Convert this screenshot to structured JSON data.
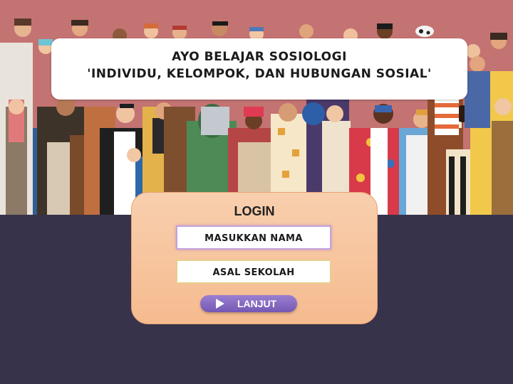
{
  "title": {
    "line1": "AYO BELAJAR SOSIOLOGI",
    "line2": "'INDIVIDU, KELOMPOK, DAN HUBUNGAN SOSIAL'"
  },
  "login": {
    "heading": "LOGIN",
    "name_field": "MASUKKAN NAMA",
    "school_field": "ASAL SEKOLAH",
    "submit_label": "LANJUT"
  },
  "icons": {
    "submit_icon": "play-icon",
    "background": "crowd-illustration"
  },
  "colors": {
    "page_background": "#37334a",
    "banner_background": "#c07070",
    "card": "#f7c29b",
    "button": "#7f62bd"
  }
}
